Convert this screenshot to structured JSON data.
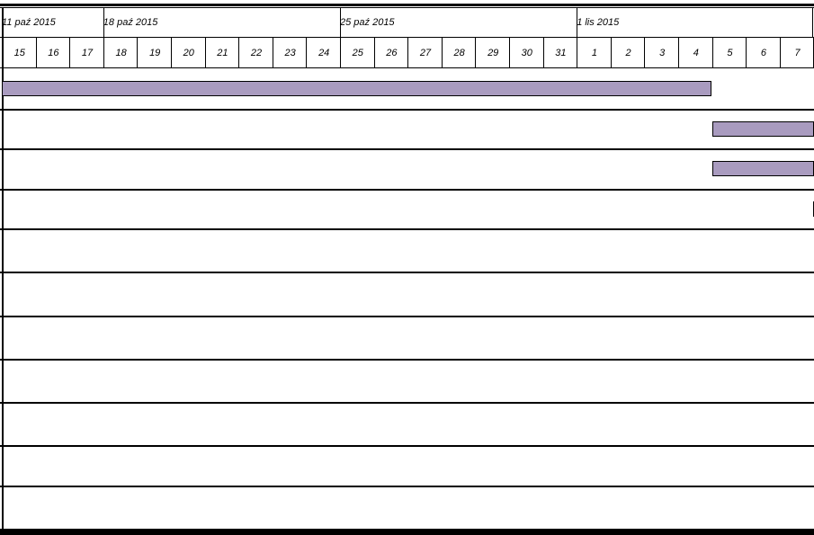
{
  "timeline": {
    "weeks": [
      {
        "label": "11 paź 2015",
        "start_day_index": 0
      },
      {
        "label": "18 paź 2015",
        "start_day_index": 3
      },
      {
        "label": "25 paź 2015",
        "start_day_index": 10
      },
      {
        "label": "1 lis 2015",
        "start_day_index": 17
      }
    ],
    "days": [
      "15",
      "16",
      "17",
      "18",
      "19",
      "20",
      "21",
      "22",
      "23",
      "24",
      "25",
      "26",
      "27",
      "28",
      "29",
      "30",
      "31",
      "1",
      "2",
      "3",
      "4",
      "5",
      "6",
      "7"
    ]
  },
  "tasks": [
    {
      "start_day_index": 0,
      "end_day_index": 20.99
    },
    {
      "start_day_index": 21,
      "end_day_index": 24
    },
    {
      "start_day_index": 21,
      "end_day_index": 24
    },
    {
      "start_day_index": 24,
      "end_day_index": 24
    },
    {},
    {},
    {},
    {},
    {},
    {},
    {}
  ],
  "colors": {
    "bar_fill": "#a99bbf",
    "grid": "#000000"
  }
}
